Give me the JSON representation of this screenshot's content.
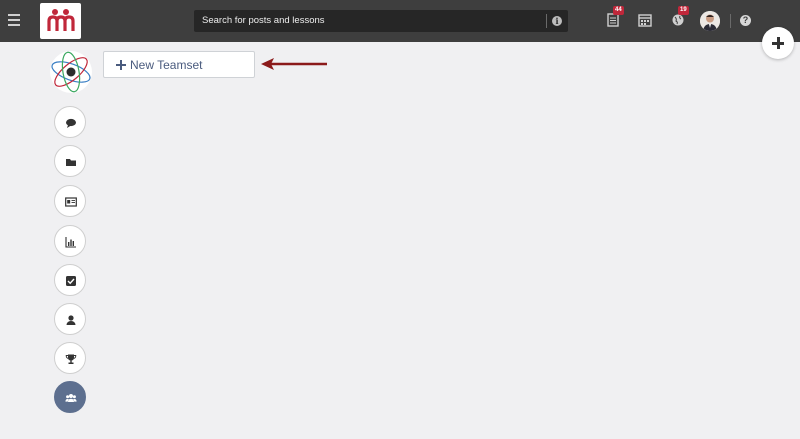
{
  "topbar": {
    "search": {
      "placeholder": "Search for posts and lessons"
    },
    "notifications": [
      {
        "name": "posts",
        "icon": "document-icon",
        "badge": "44"
      },
      {
        "name": "calendar",
        "icon": "calendar-icon",
        "badge": ""
      },
      {
        "name": "global",
        "icon": "globe-icon",
        "badge": "19"
      }
    ]
  },
  "colors": {
    "topbar": "#3e3e3e",
    "search_bg": "#262626",
    "badge": "#c0273a",
    "active_sidebar": "#5d6f8f",
    "accent_text": "#4a5b7e",
    "arrow": "#8b1a1a",
    "logo": "#c0273a"
  },
  "sidebar": {
    "items": [
      {
        "name": "comments",
        "icon": "comment-icon",
        "active": false
      },
      {
        "name": "folders",
        "icon": "folder-icon",
        "active": false
      },
      {
        "name": "profile-card",
        "icon": "id-card-icon",
        "active": false
      },
      {
        "name": "reports",
        "icon": "bar-chart-icon",
        "active": false
      },
      {
        "name": "tasks",
        "icon": "checkbox-icon",
        "active": false
      },
      {
        "name": "user",
        "icon": "user-icon",
        "active": false
      },
      {
        "name": "achievements",
        "icon": "trophy-icon",
        "active": false
      },
      {
        "name": "teams",
        "icon": "users-icon",
        "active": true
      }
    ]
  },
  "main": {
    "new_teamset_label": "New Teamset"
  }
}
